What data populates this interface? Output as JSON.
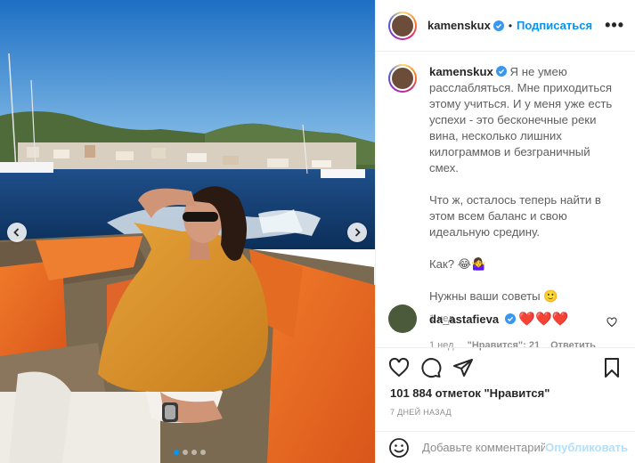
{
  "post": {
    "username": "kamenskux",
    "follow_label": "Подписаться",
    "separator": "•",
    "more_label": "•••",
    "caption": {
      "username": "kamenskux",
      "paragraph1": "Я не умею расслабляться. Мне приходиться этому учиться. И у меня уже есть успехи - это бесконечные реки вина, несколько лишних килограммов и безграничный смех.",
      "paragraph2": "Что ж, осталось теперь найти в этом всем баланс и свою идеальную средину.",
      "paragraph3": "Как? 😂🤷‍♀️",
      "paragraph4": "Нужны ваши советы 🙂",
      "time": "1 нед."
    },
    "comment": {
      "username": "da_astafieva",
      "text": "❤️❤️❤️",
      "time": "1 нед.",
      "likes": "\"Нравится\": 21",
      "reply_label": "Ответить"
    },
    "likes_text": "101 884 отметок \"Нравится\"",
    "date_text": "7 ДНЕЙ НАЗАД",
    "add_comment_placeholder": "Добавьте комментарий...",
    "publish_label": "Опубликовать",
    "carousel": {
      "current": 1,
      "total": 4
    }
  },
  "colors": {
    "accent": "#0095f6",
    "verified": "#3897f0",
    "heart": "#ed4956",
    "publish_disabled": "#b2dffc"
  }
}
